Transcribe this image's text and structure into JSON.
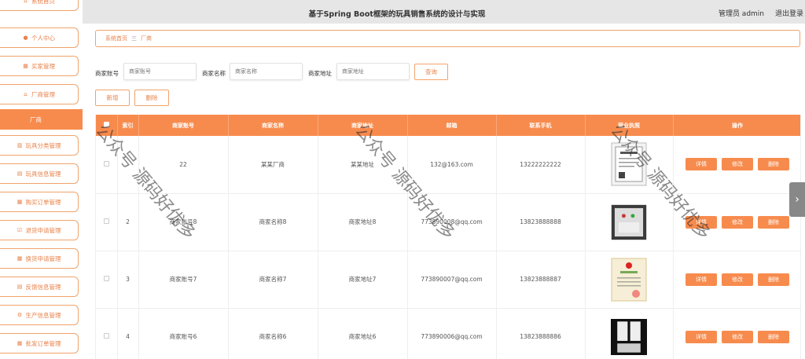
{
  "sidebar": {
    "items": [
      {
        "label": "系统首页",
        "icon": "home-icon"
      },
      {
        "label": "个人中心",
        "icon": "user-icon"
      },
      {
        "label": "买家管理",
        "icon": "grid-icon"
      },
      {
        "label": "厂商管理",
        "icon": "shop-icon"
      },
      {
        "label": "厂商",
        "icon": ""
      },
      {
        "label": "玩具分类管理",
        "icon": "chart-icon"
      },
      {
        "label": "玩具信息管理",
        "icon": "doc-icon"
      },
      {
        "label": "购买订单管理",
        "icon": "grid-icon"
      },
      {
        "label": "退货申请管理",
        "icon": "check-icon"
      },
      {
        "label": "换货申请管理",
        "icon": "grid-icon"
      },
      {
        "label": "反馈信息管理",
        "icon": "doc-icon"
      },
      {
        "label": "生产信息管理",
        "icon": "gear-icon"
      },
      {
        "label": "批发订单管理",
        "icon": "grid-icon"
      }
    ]
  },
  "header": {
    "title": "基于Spring Boot框架的玩具销售系统的设计与实现",
    "user": "管理员 admin",
    "logout": "退出登录"
  },
  "breadcrumb": {
    "home": "系统首页",
    "sep": "三",
    "current": "厂商"
  },
  "search": {
    "account_label": "商家账号",
    "account_placeholder": "商家账号",
    "name_label": "商家名称",
    "name_placeholder": "商家名称",
    "address_label": "商家地址",
    "address_placeholder": "商家地址",
    "query_button": "查询"
  },
  "toolbar": {
    "add": "新增",
    "delete": "删除"
  },
  "table": {
    "headers": [
      "索引",
      "商家账号",
      "商家名称",
      "商家地址",
      "邮箱",
      "联系手机",
      "营业执照",
      "操作"
    ],
    "rows": [
      {
        "index": "",
        "account": "22",
        "name": "某某厂商",
        "address": "某某地址",
        "email": "132@163.com",
        "phone": "13222222222"
      },
      {
        "index": "2",
        "account": "商家账号8",
        "name": "商家名称8",
        "address": "商家地址8",
        "email": "773890008@qq.com",
        "phone": "13823888888"
      },
      {
        "index": "3",
        "account": "商家账号7",
        "name": "商家名称7",
        "address": "商家地址7",
        "email": "773890007@qq.com",
        "phone": "13823888887"
      },
      {
        "index": "4",
        "account": "商家账号6",
        "name": "商家名称6",
        "address": "商家地址6",
        "email": "773890006@qq.com",
        "phone": "13823888886"
      }
    ],
    "actions": {
      "detail": "详情",
      "edit": "修改",
      "delete": "删除"
    }
  },
  "watermark": "公众号 源码好优多",
  "colors": {
    "accent": "#f78b4d",
    "border": "#f0a36b",
    "header_bg": "#e6e6e6"
  }
}
